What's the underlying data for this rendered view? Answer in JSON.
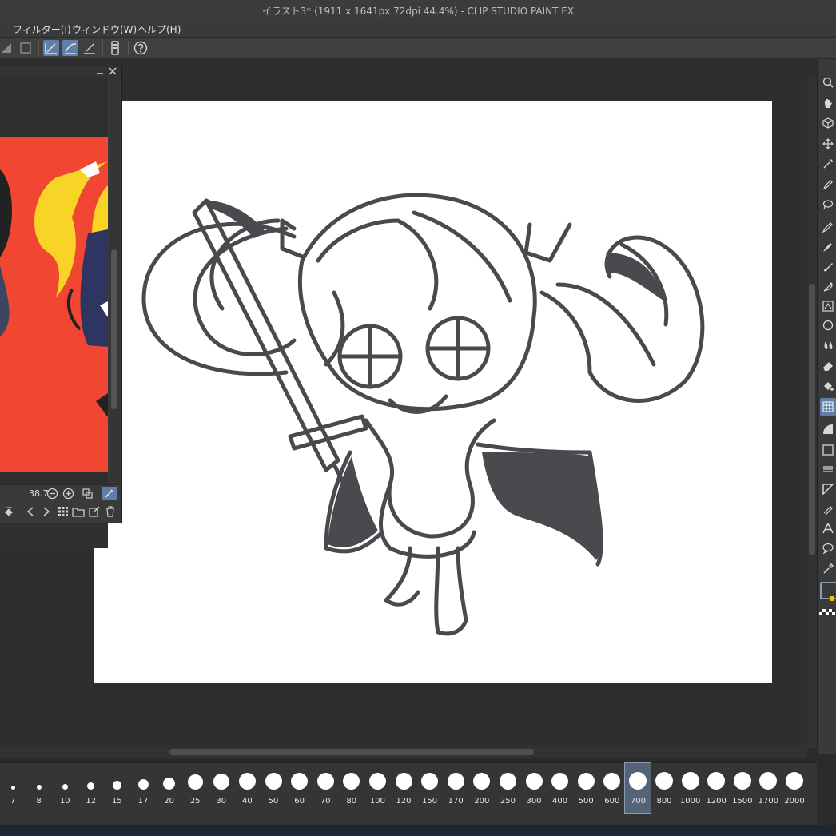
{
  "window": {
    "title": "イラスト3* (1911 x 1641px 72dpi 44.4%)  - CLIP STUDIO PAINT EX"
  },
  "menu": {
    "items": [
      "フィルター(I)",
      "ウィンドウ(W)",
      "ヘルプ(H)"
    ]
  },
  "navigator": {
    "zoom_value": "38.7"
  },
  "brush_sizes": [
    "7",
    "8",
    "10",
    "12",
    "15",
    "17",
    "20",
    "25",
    "30",
    "40",
    "50",
    "60",
    "70",
    "80",
    "100",
    "120",
    "150",
    "170",
    "200",
    "250",
    "300",
    "400",
    "500",
    "600",
    "700",
    "800",
    "1000",
    "1200",
    "1500",
    "1700",
    "2000"
  ],
  "selected_brush_size": "700",
  "colors": {
    "accent": "#5f7fa8",
    "canvas": "#ffffff",
    "navigator_bg": "#f04632",
    "lineart": "#4a494e"
  }
}
